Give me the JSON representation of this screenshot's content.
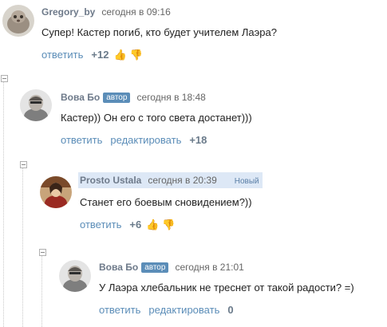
{
  "comments": [
    {
      "author": "Gregory_by",
      "time": "сегодня в 09:16",
      "text": "Супер! Кастер погиб, кто будет учителем Лаэра?",
      "reply": "ответить",
      "score": "+12"
    },
    {
      "author": "Вова Бо",
      "badge": "автор",
      "time": "сегодня в 18:48",
      "text": "Кастер)) Он его с того света достанет)))",
      "reply": "ответить",
      "edit": "редактировать",
      "score": "+18"
    },
    {
      "author": "Prosto Ustala",
      "time": "сегодня в 20:39",
      "new_label": "Новый",
      "text": "Станет его боевым сновидением?))",
      "reply": "ответить",
      "score": "+6"
    },
    {
      "author": "Вова Бо",
      "badge": "автор",
      "time": "сегодня в 21:01",
      "text": "У Лаэра хлебальник не треснет от такой радости? =)",
      "reply": "ответить",
      "edit": "редактировать",
      "score": "0"
    }
  ],
  "icons": {
    "vote_up": "thumbs-up-icon",
    "vote_down": "thumbs-down-icon",
    "collapse": "collapse-icon"
  },
  "colors": {
    "link": "#5b8db8",
    "vote_up": "#7ab317",
    "highlight": "#dde8f6",
    "badge": "#5b8db8"
  }
}
